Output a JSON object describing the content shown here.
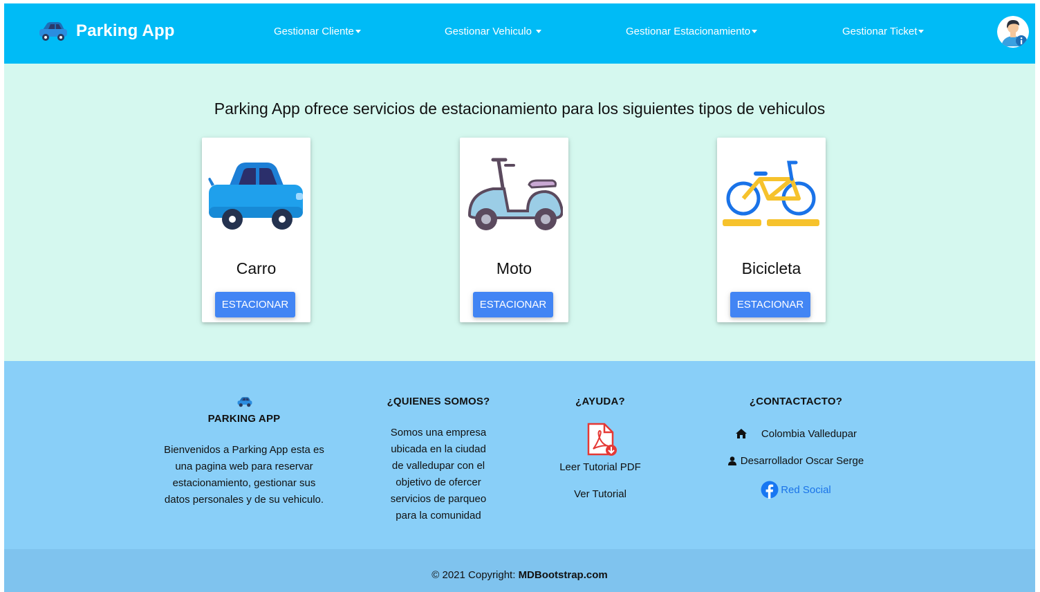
{
  "navbar": {
    "brand": "Parking App",
    "menu": [
      {
        "label": "Gestionar Cliente"
      },
      {
        "label": "Gestionar Vehiculo "
      },
      {
        "label": "Gestionar Estacionamiento"
      },
      {
        "label": "Gestionar Ticket"
      }
    ]
  },
  "main": {
    "title": "Parking App ofrece servicios de estacionamiento para los siguientes tipos de vehiculos",
    "cards": [
      {
        "title": "Carro",
        "button": "ESTACIONAR",
        "icon": "car-icon"
      },
      {
        "title": "Moto",
        "button": "ESTACIONAR",
        "icon": "scooter-icon"
      },
      {
        "title": "Bicicleta",
        "button": "ESTACIONAR",
        "icon": "bicycle-icon"
      }
    ]
  },
  "footer": {
    "about": {
      "heading": "PARKING APP",
      "lines": [
        "Bienvenidos a Parking App esta es",
        "una pagina web para reservar",
        "estacionamiento, gestionar sus",
        "datos personales y de su vehiculo."
      ]
    },
    "who": {
      "heading": "¿QUIENES SOMOS?",
      "lines": [
        "Somos una empresa",
        "ubicada en la ciudad",
        "de valledupar con el",
        "objetivo de ofercer",
        "servicios de parqueo",
        "para la comunidad"
      ]
    },
    "help": {
      "heading": "¿AYUDA?",
      "pdf_link": "Leer Tutorial PDF",
      "video_link": "Ver Tutorial"
    },
    "contact": {
      "heading": "¿CONTACTACTO?",
      "location": "Colombia Valledupar",
      "developer": "Desarrollador Oscar Serge",
      "social": "Red Social"
    }
  },
  "copyright": {
    "prefix": "© 2021 Copyright: ",
    "link": "MDBootstrap.com"
  },
  "colors": {
    "navbar": "#00bbf6",
    "main_bg": "#d5f8ef",
    "footer_bg": "#89cff8",
    "copyright_bg": "#7fc3ee",
    "button": "#4285f4",
    "link": "#1a73e8"
  }
}
